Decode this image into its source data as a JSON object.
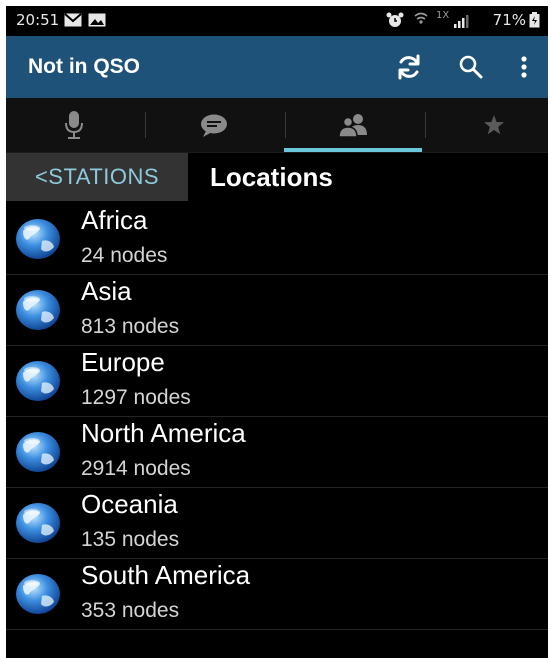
{
  "statusbar": {
    "time": "20:51",
    "network": "1X",
    "battery": "71%"
  },
  "actionbar": {
    "title": "Not in QSO"
  },
  "tabs": [
    {
      "icon": "microphone-icon"
    },
    {
      "icon": "chat-icon"
    },
    {
      "icon": "people-icon",
      "selected": true
    },
    {
      "icon": "star-icon"
    }
  ],
  "breadcrumb": {
    "back_label": "<STATIONS",
    "title": "Locations"
  },
  "locations": [
    {
      "name": "Africa",
      "count": "24 nodes"
    },
    {
      "name": "Asia",
      "count": "813 nodes"
    },
    {
      "name": "Europe",
      "count": "1297 nodes"
    },
    {
      "name": "North America",
      "count": "2914 nodes"
    },
    {
      "name": "Oceania",
      "count": "135 nodes"
    },
    {
      "name": "South America",
      "count": "353 nodes"
    }
  ],
  "colors": {
    "actionbar": "#1f5278",
    "accent": "#6cc7dc",
    "background": "#000000"
  }
}
